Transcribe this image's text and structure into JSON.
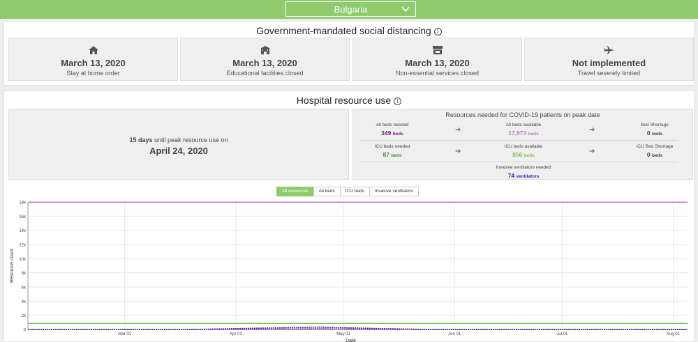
{
  "country": {
    "selected": "Bulgaria"
  },
  "social_distancing": {
    "title": "Government-mandated social distancing",
    "info": "i",
    "cards": [
      {
        "icon": "home-icon",
        "date": "March 13, 2020",
        "desc": "Stay at home order"
      },
      {
        "icon": "school-icon",
        "date": "March 13, 2020",
        "desc": "Educational facilities closed"
      },
      {
        "icon": "store-icon",
        "date": "March 13, 2020",
        "desc": "Non-essential services closed"
      },
      {
        "icon": "plane-icon",
        "date": "Not implemented",
        "desc": "Travel severely limited"
      }
    ]
  },
  "hospital": {
    "title": "Hospital resource use",
    "info": "i",
    "peak": {
      "days": "15 days",
      "until_text": " until peak resource use on",
      "date": "April 24, 2020"
    },
    "resources": {
      "title": "Resources needed for COVID-19 patients on peak date",
      "all_beds_needed": {
        "label": "All beds needed",
        "value": "349",
        "unit": "beds"
      },
      "all_beds_available": {
        "label": "All beds available",
        "value": "17,973",
        "unit": "beds"
      },
      "bed_shortage": {
        "label": "Bed Shortage",
        "value": "0",
        "unit": "beds"
      },
      "icu_beds_needed": {
        "label": "ICU beds needed",
        "value": "87",
        "unit": "beds"
      },
      "icu_beds_available": {
        "label": "ICU beds available",
        "value": "856",
        "unit": "beds"
      },
      "icu_bed_shortage": {
        "label": "ICU Bed Shortage",
        "value": "0",
        "unit": "beds"
      },
      "ventilators_needed": {
        "label": "Invasive ventilators needed",
        "value": "74",
        "unit": "ventilators"
      }
    },
    "tabs": [
      "All resources",
      "All beds",
      "ICU beds",
      "Invasive ventilators"
    ],
    "active_tab": "All resources"
  },
  "colors": {
    "accent_green": "#8fcb6d",
    "all_beds_needed": "#7b1d83",
    "all_beds_available": "#c27ad0",
    "icu_beds_needed": "#3a8f29",
    "icu_beds_available": "#78c25e",
    "ventilators": "#2e2ab8"
  },
  "chart_data": {
    "type": "line",
    "ylabel": "Resource count",
    "xlabel": "Date",
    "ylim": [
      0,
      18000
    ],
    "y_ticks": [
      "0",
      "2k",
      "4k",
      "6k",
      "8k",
      "10k",
      "12k",
      "14k",
      "16k",
      "18k"
    ],
    "x_ticks": [
      "Mar 01",
      "Apr 01",
      "May 01",
      "Jun 01",
      "Jul 01",
      "Aug 01"
    ],
    "x_range": [
      "2020-02-03",
      "2020-08-05"
    ],
    "grid": true,
    "series": [
      {
        "name": "All beds available",
        "values": [
          [
            "2020-02-03",
            17973
          ],
          [
            "2020-08-05",
            17973
          ]
        ]
      },
      {
        "name": "ICU beds available",
        "values": [
          [
            "2020-02-03",
            856
          ],
          [
            "2020-08-05",
            856
          ]
        ]
      },
      {
        "name": "All beds needed",
        "values": [
          [
            "2020-02-03",
            0
          ],
          [
            "2020-03-20",
            0
          ],
          [
            "2020-04-01",
            120
          ],
          [
            "2020-04-24",
            349
          ],
          [
            "2020-05-10",
            140
          ],
          [
            "2020-05-25",
            0
          ],
          [
            "2020-08-05",
            0
          ]
        ]
      },
      {
        "name": "Invasive ventilators needed",
        "values": [
          [
            "2020-02-03",
            0
          ],
          [
            "2020-03-25",
            0
          ],
          [
            "2020-04-24",
            74
          ],
          [
            "2020-05-20",
            0
          ],
          [
            "2020-08-05",
            0
          ]
        ]
      }
    ]
  }
}
